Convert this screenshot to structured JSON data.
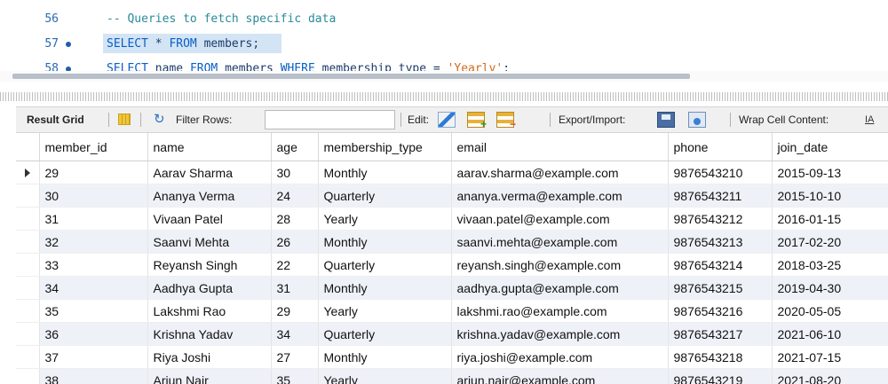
{
  "editor": {
    "lines": [
      {
        "num": "56",
        "comment": "-- Queries to fetch specific data"
      },
      {
        "num": "57",
        "select_kw": "SELECT",
        "star": " * ",
        "from_kw": "FROM",
        "table": " members;"
      },
      {
        "num": "58",
        "select_kw": "SELECT",
        "cols": " name ",
        "from_kw": "FROM",
        "table": " members ",
        "where_kw": "WHERE",
        "cond": " membership_type = ",
        "value": "'Yearly'",
        "end": ";"
      }
    ]
  },
  "toolbar": {
    "result_grid_label": "Result Grid",
    "filter_label": "Filter Rows:",
    "filter_value": "",
    "edit_label": "Edit:",
    "export_label": "Export/Import:",
    "wrap_label": "Wrap Cell Content:",
    "wrap_icon": "IA"
  },
  "grid": {
    "columns": [
      "member_id",
      "name",
      "age",
      "membership_type",
      "email",
      "phone",
      "join_date"
    ],
    "rows": [
      [
        "29",
        "Aarav Sharma",
        "30",
        "Monthly",
        "aarav.sharma@example.com",
        "9876543210",
        "2015-09-13"
      ],
      [
        "30",
        "Ananya Verma",
        "24",
        "Quarterly",
        "ananya.verma@example.com",
        "9876543211",
        "2015-10-10"
      ],
      [
        "31",
        "Vivaan Patel",
        "28",
        "Yearly",
        "vivaan.patel@example.com",
        "9876543212",
        "2016-01-15"
      ],
      [
        "32",
        "Saanvi Mehta",
        "26",
        "Monthly",
        "saanvi.mehta@example.com",
        "9876543213",
        "2017-02-20"
      ],
      [
        "33",
        "Reyansh Singh",
        "22",
        "Quarterly",
        "reyansh.singh@example.com",
        "9876543214",
        "2018-03-25"
      ],
      [
        "34",
        "Aadhya Gupta",
        "31",
        "Monthly",
        "aadhya.gupta@example.com",
        "9876543215",
        "2019-04-30"
      ],
      [
        "35",
        "Lakshmi Rao",
        "29",
        "Yearly",
        "lakshmi.rao@example.com",
        "9876543216",
        "2020-05-05"
      ],
      [
        "36",
        "Krishna Yadav",
        "34",
        "Quarterly",
        "krishna.yadav@example.com",
        "9876543217",
        "2021-06-10"
      ],
      [
        "37",
        "Riya Joshi",
        "27",
        "Monthly",
        "riya.joshi@example.com",
        "9876543218",
        "2021-07-15"
      ],
      [
        "38",
        "Arjun Nair",
        "35",
        "Yearly",
        "arjun.nair@example.com",
        "9876543219",
        "2021-08-20"
      ]
    ]
  }
}
